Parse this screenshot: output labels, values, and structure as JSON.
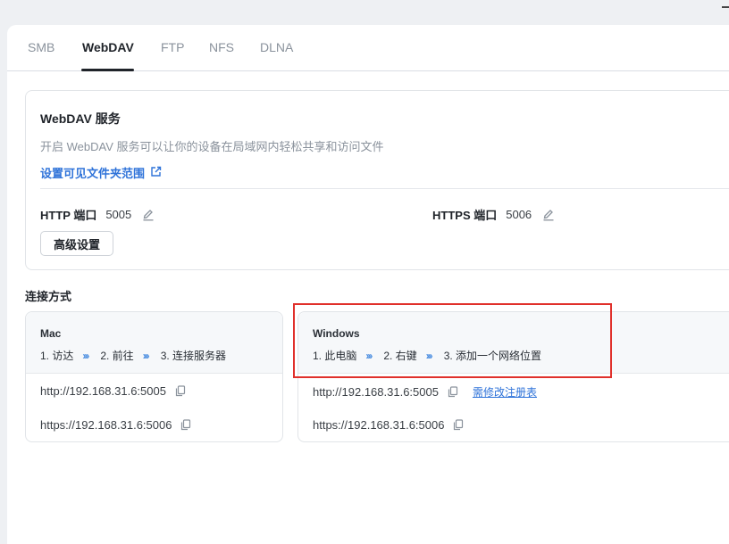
{
  "tabs": [
    "SMB",
    "WebDAV",
    "FTP",
    "NFS",
    "DLNA"
  ],
  "active_tab": "WebDAV",
  "service": {
    "title": "WebDAV 服务",
    "description": "开启 WebDAV 服务可以让你的设备在局域网内轻松共享和访问文件",
    "link": "设置可见文件夹范围",
    "http_label": "HTTP 端口",
    "http_port": "5005",
    "https_label": "HTTPS 端口",
    "https_port": "5006",
    "advanced_button": "高级设置"
  },
  "connection": {
    "title": "连接方式",
    "mac": {
      "name": "Mac",
      "steps": [
        "1. 访达",
        "2. 前往",
        "3. 连接服务器"
      ],
      "urls": [
        "http://192.168.31.6:5005",
        "https://192.168.31.6:5006"
      ]
    },
    "windows": {
      "name": "Windows",
      "steps": [
        "1. 此电脑",
        "2. 右键",
        "3. 添加一个网络位置"
      ],
      "urls": [
        "http://192.168.31.6:5005",
        "https://192.168.31.6:5006"
      ],
      "registry_link": "需修改注册表"
    }
  },
  "icons": {
    "external_link": "external-link-icon",
    "edit": "pencil-icon",
    "copy": "copy-icon",
    "steps_arrow": "triple-chevron-right-icon"
  },
  "colors": {
    "accent": "#2f73d9",
    "arrow": "#4a8de0",
    "highlight": "#e0302b"
  }
}
